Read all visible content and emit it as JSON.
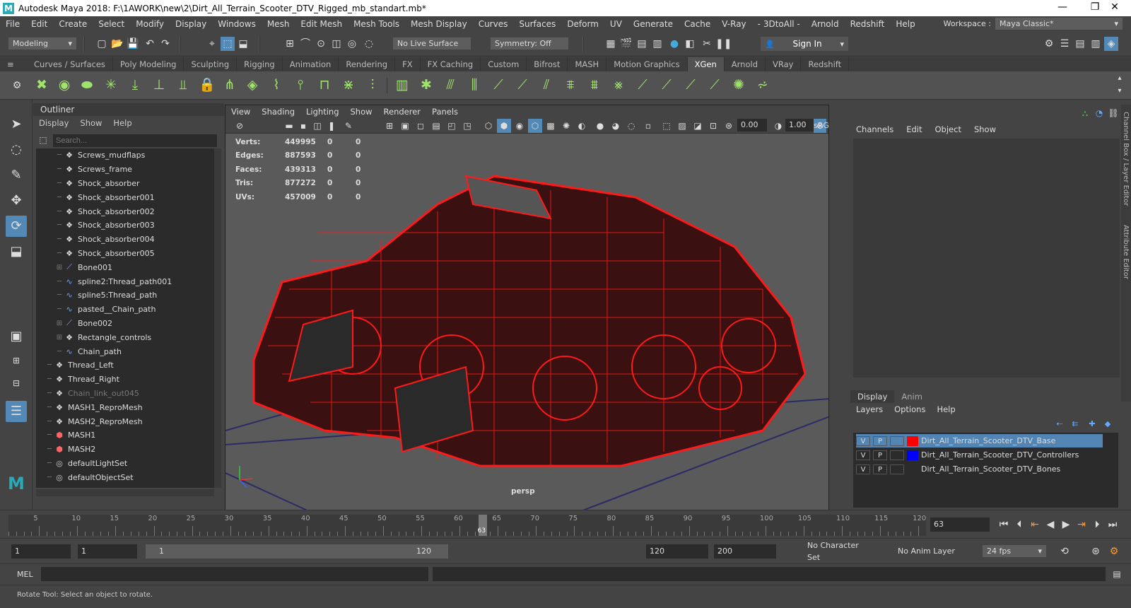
{
  "app": {
    "title": "Autodesk Maya 2018: F:\\1AWORK\\new\\2\\Dirt_All_Terrain_Scooter_DTV_Rigged_mb_standart.mb*"
  },
  "window_buttons": [
    "—",
    "❐",
    "✕"
  ],
  "menus": [
    "File",
    "Edit",
    "Create",
    "Select",
    "Modify",
    "Display",
    "Windows",
    "Mesh",
    "Edit Mesh",
    "Mesh Tools",
    "Mesh Display",
    "Curves",
    "Surfaces",
    "Deform",
    "UV",
    "Generate",
    "Cache",
    "V-Ray",
    "- 3DtoAll -",
    "Arnold",
    "Redshift",
    "Help"
  ],
  "workspace": {
    "label": "Workspace :",
    "value": "Maya Classic*"
  },
  "status": {
    "mode": "Modeling",
    "live_surface": "No Live Surface",
    "symmetry": "Symmetry: Off",
    "sign_in": "Sign In"
  },
  "shelf_tabs": [
    "Curves / Surfaces",
    "Poly Modeling",
    "Sculpting",
    "Rigging",
    "Animation",
    "Rendering",
    "FX",
    "FX Caching",
    "Custom",
    "Bifrost",
    "MASH",
    "Motion Graphics",
    "XGen",
    "Arnold",
    "VRay",
    "Redshift"
  ],
  "shelf_active": "XGen",
  "outliner": {
    "title": "Outliner",
    "menus": [
      "Display",
      "Show",
      "Help"
    ],
    "search_placeholder": "Search...",
    "items": [
      {
        "label": "Screws_mudflaps",
        "icon": "mesh-icon"
      },
      {
        "label": "Screws_frame",
        "icon": "mesh-icon"
      },
      {
        "label": "Shock_absorber",
        "icon": "mesh-icon"
      },
      {
        "label": "Shock_absorber001",
        "icon": "mesh-icon"
      },
      {
        "label": "Shock_absorber002",
        "icon": "mesh-icon"
      },
      {
        "label": "Shock_absorber003",
        "icon": "mesh-icon"
      },
      {
        "label": "Shock_absorber004",
        "icon": "mesh-icon"
      },
      {
        "label": "Shock_absorber005",
        "icon": "mesh-icon"
      },
      {
        "label": "Bone001",
        "icon": "bone-icon"
      },
      {
        "label": "spline2:Thread_path001",
        "icon": "curve-icon"
      },
      {
        "label": "spline5:Thread_path",
        "icon": "curve-icon"
      },
      {
        "label": "pasted__Chain_path",
        "icon": "curve-icon"
      },
      {
        "label": "Bone002",
        "icon": "bone-icon"
      },
      {
        "label": "Rectangle_controls",
        "icon": "mesh-icon"
      },
      {
        "label": "Chain_path",
        "icon": "curve-icon"
      },
      {
        "label": "Thread_Left",
        "icon": "mesh-icon"
      },
      {
        "label": "Thread_Right",
        "icon": "mesh-icon"
      },
      {
        "label": "Chain_link_out045",
        "icon": "mesh-icon"
      },
      {
        "label": "MASH1_ReproMesh",
        "icon": "mesh-icon"
      },
      {
        "label": "MASH2_ReproMesh",
        "icon": "mesh-icon"
      },
      {
        "label": "MASH1",
        "icon": "mash-icon"
      },
      {
        "label": "MASH2",
        "icon": "mash-icon"
      },
      {
        "label": "defaultLightSet",
        "icon": "set-icon"
      },
      {
        "label": "defaultObjectSet",
        "icon": "set-icon"
      }
    ]
  },
  "viewport": {
    "menus": [
      "View",
      "Shading",
      "Lighting",
      "Show",
      "Renderer",
      "Panels"
    ],
    "gamma": "0.00",
    "exposure": "1.00",
    "colorspace": "sRGB",
    "camera": "persp",
    "hud": [
      {
        "label": "Verts:",
        "value": "449995",
        "a": "0",
        "b": "0"
      },
      {
        "label": "Edges:",
        "value": "887593",
        "a": "0",
        "b": "0"
      },
      {
        "label": "Faces:",
        "value": "439313",
        "a": "0",
        "b": "0"
      },
      {
        "label": "Tris:",
        "value": "877272",
        "a": "0",
        "b": "0"
      },
      {
        "label": "UVs:",
        "value": "457009",
        "a": "0",
        "b": "0"
      }
    ]
  },
  "channelbox": {
    "menus": [
      "Channels",
      "Edit",
      "Object",
      "Show"
    ]
  },
  "side_tabs": [
    "Channel Box / Layer Editor",
    "Attribute Editor"
  ],
  "layers": {
    "tabs": [
      "Display",
      "Anim"
    ],
    "menus": [
      "Layers",
      "Options",
      "Help"
    ],
    "items": [
      {
        "v": "V",
        "p": "P",
        "color": "#ff0000",
        "label": "Dirt_All_Terrain_Scooter_DTV_Base"
      },
      {
        "v": "V",
        "p": "P",
        "color": "#0000ff",
        "label": "Dirt_All_Terrain_Scooter_DTV_Controllers"
      },
      {
        "v": "V",
        "p": "P",
        "color": "#2b2b2b",
        "label": "Dirt_All_Terrain_Scooter_DTV_Bones"
      }
    ]
  },
  "timeline": {
    "ticks": [
      "5",
      "10",
      "15",
      "20",
      "25",
      "30",
      "35",
      "40",
      "45",
      "50",
      "55",
      "60",
      "65",
      "70",
      "75",
      "80",
      "85",
      "90",
      "95",
      "100",
      "105",
      "110",
      "115",
      "120"
    ],
    "current": "63",
    "current_field": "63"
  },
  "range": {
    "start": "1",
    "start2": "1",
    "slider_start": "1",
    "slider_end": "120",
    "end": "120",
    "end2": "200",
    "char_set": "No Character Set",
    "anim_layer": "No Anim Layer",
    "fps": "24 fps"
  },
  "cmd": {
    "label": "MEL"
  },
  "help": {
    "text": "Rotate Tool: Select an object to rotate."
  }
}
